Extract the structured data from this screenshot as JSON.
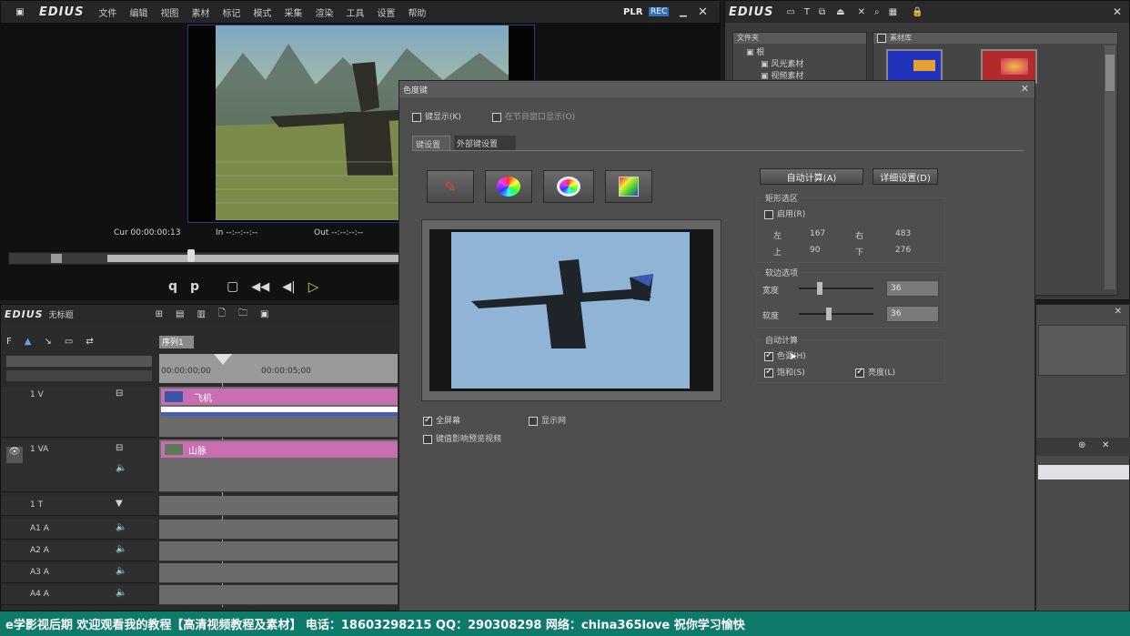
{
  "player": {
    "logo": "EDIUS",
    "menu": [
      "文件",
      "编辑",
      "视图",
      "素材",
      "标记",
      "模式",
      "采集",
      "渲染",
      "工具",
      "设置",
      "帮助"
    ],
    "mode": "PLR",
    "mode_badge": "REC",
    "cur_label": "Cur 00:00:00:13",
    "in_label": "In --:--:--:--",
    "out_label": "Out --:--:--:--"
  },
  "bin": {
    "logo": "EDIUS",
    "folder_header": "文件夹",
    "tree_root": "根",
    "tree_child": "风光素材",
    "tree_child2": "视频素材",
    "thumb_header": "素材库"
  },
  "timeline": {
    "logo": "EDIUS",
    "sequence": "无标题",
    "tab": "序列1",
    "ruler_start": "00:00:00;00",
    "ruler_mid": "00:00:05;00",
    "tracks": [
      {
        "name": "1 V",
        "type": "v"
      },
      {
        "name": "1 VA",
        "type": "va"
      },
      {
        "name": "1 T",
        "type": "t"
      },
      {
        "name": "A1 A",
        "type": "a"
      },
      {
        "name": "A2 A",
        "type": "a"
      },
      {
        "name": "A3 A",
        "type": "a"
      },
      {
        "name": "A4 A",
        "type": "a"
      }
    ],
    "clip1": "飞机",
    "clip2": "山脉"
  },
  "dialog": {
    "title": "色度键",
    "opt_preview": "键显示(K)",
    "opt_realtime": "在节目窗口显示(O)",
    "tab_basic": "键设置",
    "tab_advanced": "外部键设置",
    "btn_auto": "自动计算(A)",
    "btn_detail": "详细设置(D)",
    "grp_frame": "矩形选区",
    "frame_enable": "启用(R)",
    "left_label": "左",
    "left_val": "167",
    "right_label": "右",
    "right_val": "483",
    "top_label": "上",
    "top_val": "90",
    "bottom_label": "下",
    "bottom_val": "276",
    "grp_soft": "软边选项",
    "width_label": "宽度",
    "width_val": "36",
    "softness_label": "软度",
    "softness_val": "36",
    "grp_auto": "自动计算",
    "auto_hue": "色调(H)",
    "auto_sat": "饱和(S)",
    "auto_lum": "亮度(L)",
    "chk_fullscreen": "全屏幕",
    "chk_outline": "显示网",
    "chk_link": "键值影响预览视频"
  },
  "banner": {
    "text": "e学影视后期 欢迎观看我的教程【高清视频教程及素材】 电话：18603298215 QQ：290308298 网络：china365love 祝你学习愉快"
  },
  "colors": {
    "accent_blue": "#2e6fb8",
    "clip_pink": "#c96fb1",
    "banner_green": "#0d7a6a",
    "dialog_bg": "#4e4e4e"
  }
}
